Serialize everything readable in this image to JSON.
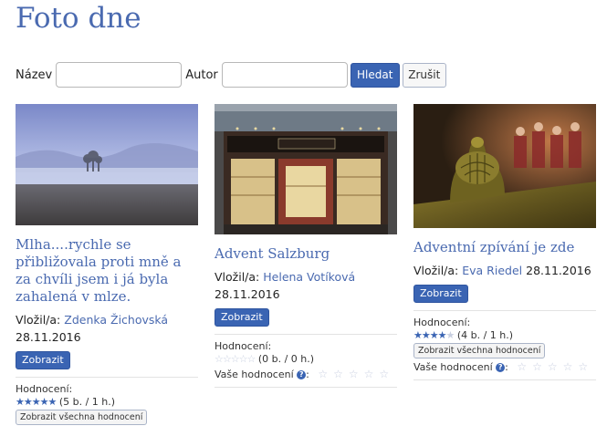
{
  "page": {
    "title": "Foto dne"
  },
  "search": {
    "name_label": "Název",
    "author_label": "Autor",
    "name_value": "",
    "author_value": "",
    "search_button": "Hledat",
    "cancel_button": "Zrušit"
  },
  "common": {
    "posted_by_label": "Vložil/a:",
    "show_button": "Zobrazit",
    "rating_label": "Hodnocení:",
    "all_ratings_button": "Zobrazit všechna hodnocení",
    "your_rating_label": "Vaše hodnocení",
    "help_glyph": "?"
  },
  "photos": [
    {
      "title": "Mlha....rychle se přibližovala proti mně a za chvíli jsem i já byla zahalená v mlze.",
      "author": "Zdenka Žichovská",
      "date": "28.11.2016",
      "rating_text": "(5 b. / 1 h.)",
      "stars_filled": 5,
      "image": "foggy-valley-landscape"
    },
    {
      "title": "Advent Salzburg",
      "author": "Helena Votíková",
      "date": "28.11.2016",
      "rating_text": "(0 b. / 0 h.)",
      "stars_filled": 0,
      "image": "salzburg-shop-front"
    },
    {
      "title": "Adventní zpívání je zde",
      "author": "Eva Riedel",
      "date": "28.11.2016",
      "rating_text": "(4 b. / 1 h.)",
      "stars_filled": 4,
      "image": "church-pew-interior"
    }
  ],
  "colors": {
    "accent": "#3a64b3",
    "title": "#4a6ab0"
  }
}
